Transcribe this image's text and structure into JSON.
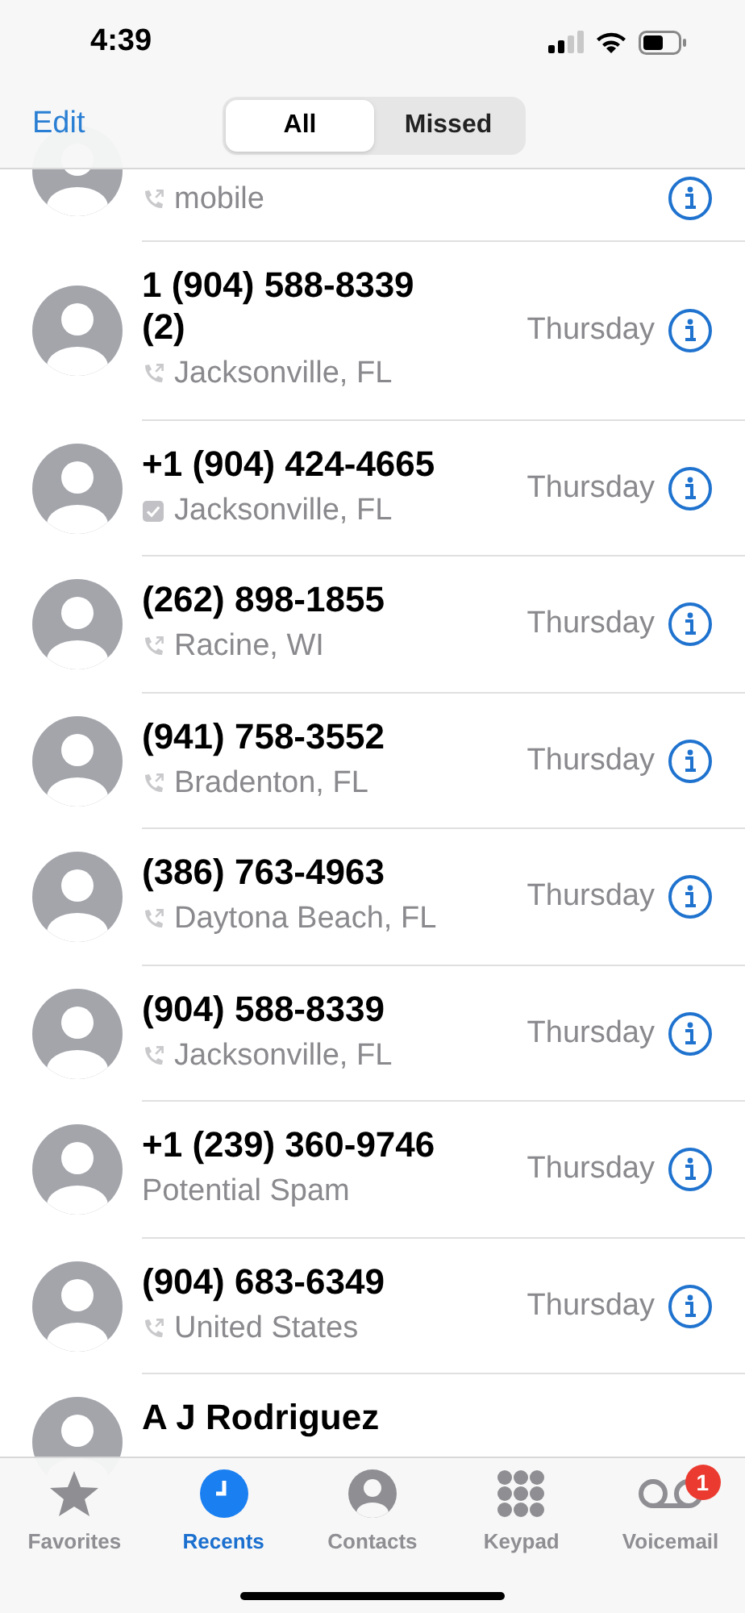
{
  "status_bar": {
    "time": "4:39"
  },
  "nav": {
    "edit": "Edit",
    "segments": [
      {
        "label": "All",
        "selected": true
      },
      {
        "label": "Missed",
        "selected": false
      }
    ]
  },
  "calls": [
    {
      "subtitle": "mobile",
      "kind": "call"
    },
    {
      "name": "1 (904) 588-8339 (2)",
      "subtitle": "Jacksonville, FL",
      "kind": "call",
      "day": "Thursday"
    },
    {
      "name": "+1 (904) 424-4665",
      "subtitle": "Jacksonville, FL",
      "kind": "verified",
      "day": "Thursday"
    },
    {
      "name": "(262) 898-1855",
      "subtitle": "Racine, WI",
      "kind": "call",
      "day": "Thursday"
    },
    {
      "name": "(941) 758-3552",
      "subtitle": "Bradenton, FL",
      "kind": "call",
      "day": "Thursday"
    },
    {
      "name": "(386) 763-4963",
      "subtitle": "Daytona Beach, FL",
      "kind": "call",
      "day": "Thursday"
    },
    {
      "name": "(904) 588-8339",
      "subtitle": "Jacksonville, FL",
      "kind": "call",
      "day": "Thursday"
    },
    {
      "name": "+1 (239) 360-9746",
      "subtitle": "Potential Spam",
      "kind": "spam",
      "day": "Thursday"
    },
    {
      "name": "(904) 683-6349",
      "subtitle": "United States",
      "kind": "call",
      "day": "Thursday"
    },
    {
      "name": "A J Rodriguez"
    }
  ],
  "tabs": [
    {
      "label": "Favorites",
      "kind": "star",
      "selected": false
    },
    {
      "label": "Recents",
      "kind": "clock",
      "selected": true
    },
    {
      "label": "Contacts",
      "kind": "person",
      "selected": false
    },
    {
      "label": "Keypad",
      "kind": "keypad",
      "selected": false
    },
    {
      "label": "Voicemail",
      "kind": "voicemail",
      "selected": false,
      "badge": "1"
    }
  ]
}
